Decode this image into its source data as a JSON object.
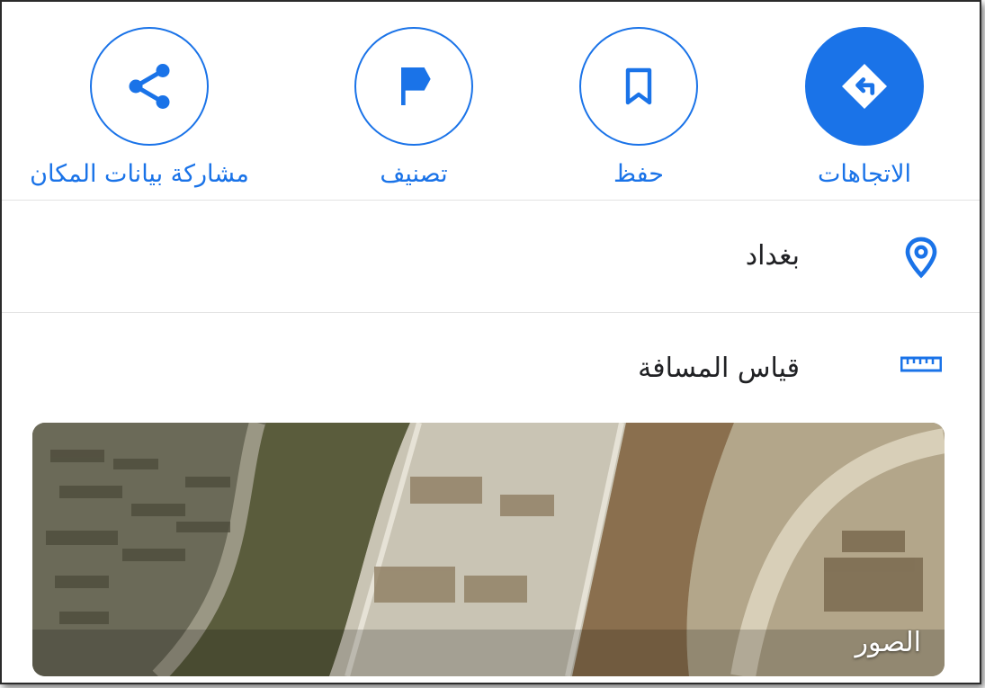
{
  "actions": [
    {
      "label": "مشاركة بيانات المكان",
      "icon": "share-icon"
    },
    {
      "label": "تصنيف",
      "icon": "flag-icon"
    },
    {
      "label": "حفظ",
      "icon": "bookmark-icon"
    },
    {
      "label": "الاتجاهات",
      "icon": "directions-icon"
    }
  ],
  "location": {
    "text": "بغداد",
    "icon": "location-pin-icon"
  },
  "measure": {
    "text": "قياس المسافة",
    "icon": "ruler-icon"
  },
  "photos": {
    "label": "الصور"
  },
  "colors": {
    "accent": "#1a73e8",
    "text": "#202124",
    "divider": "#e3e3e3"
  }
}
